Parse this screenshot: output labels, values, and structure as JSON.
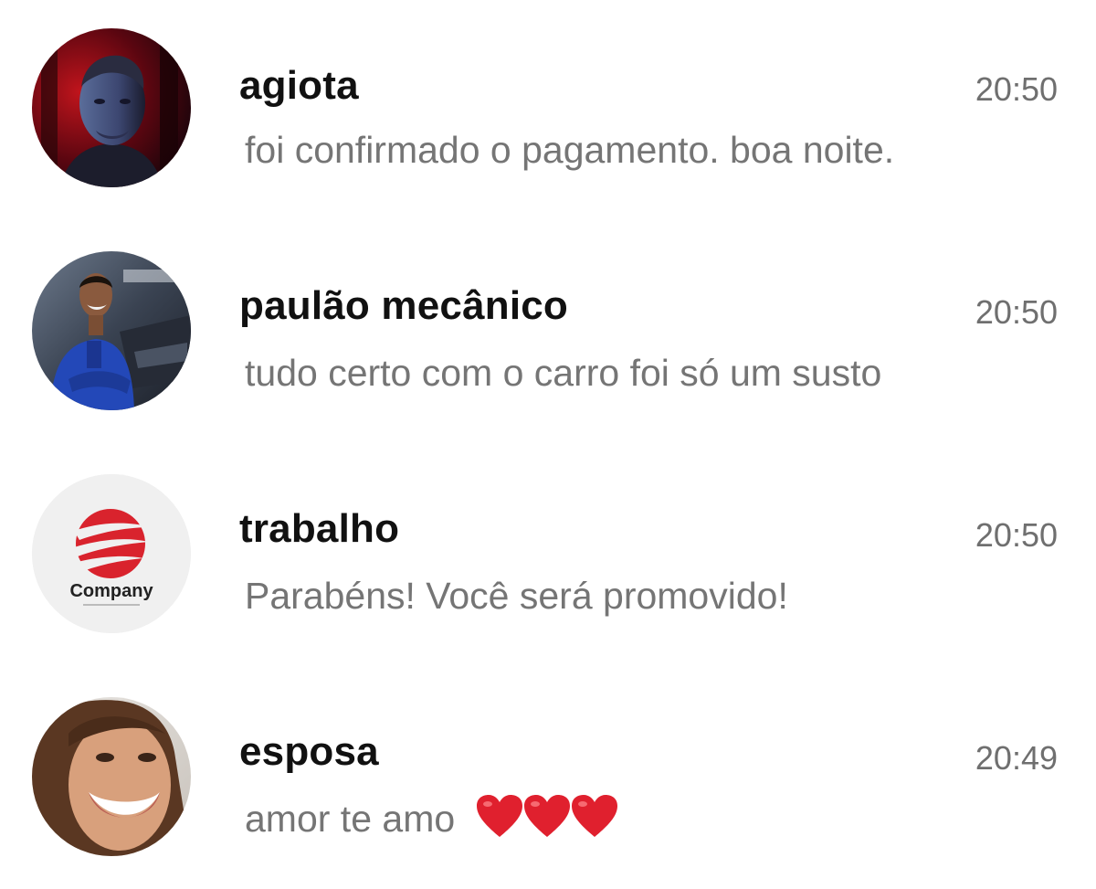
{
  "chats": [
    {
      "name": "agiota",
      "time": "20:50",
      "preview": "foi confirmado o pagamento. boa noite.",
      "avatar": "man-red-lit-portrait"
    },
    {
      "name": "paulão mecânico",
      "time": "20:50",
      "preview": "tudo certo com o carro foi só um susto",
      "avatar": "mechanic-blue-overalls"
    },
    {
      "name": "trabalho",
      "time": "20:50",
      "preview": "Parabéns! Você será promovido!",
      "avatar": "company-logo",
      "avatar_label": "Company"
    },
    {
      "name": "esposa",
      "time": "20:49",
      "preview": "amor te amo",
      "avatar": "smiling-woman",
      "emoji": [
        "red-heart-icon",
        "red-heart-icon",
        "red-heart-icon"
      ]
    }
  ],
  "colors": {
    "name": "#111111",
    "time": "#6f6f6f",
    "preview": "#757575",
    "heart": "#e0202e",
    "company_logo": "#d9232d"
  }
}
